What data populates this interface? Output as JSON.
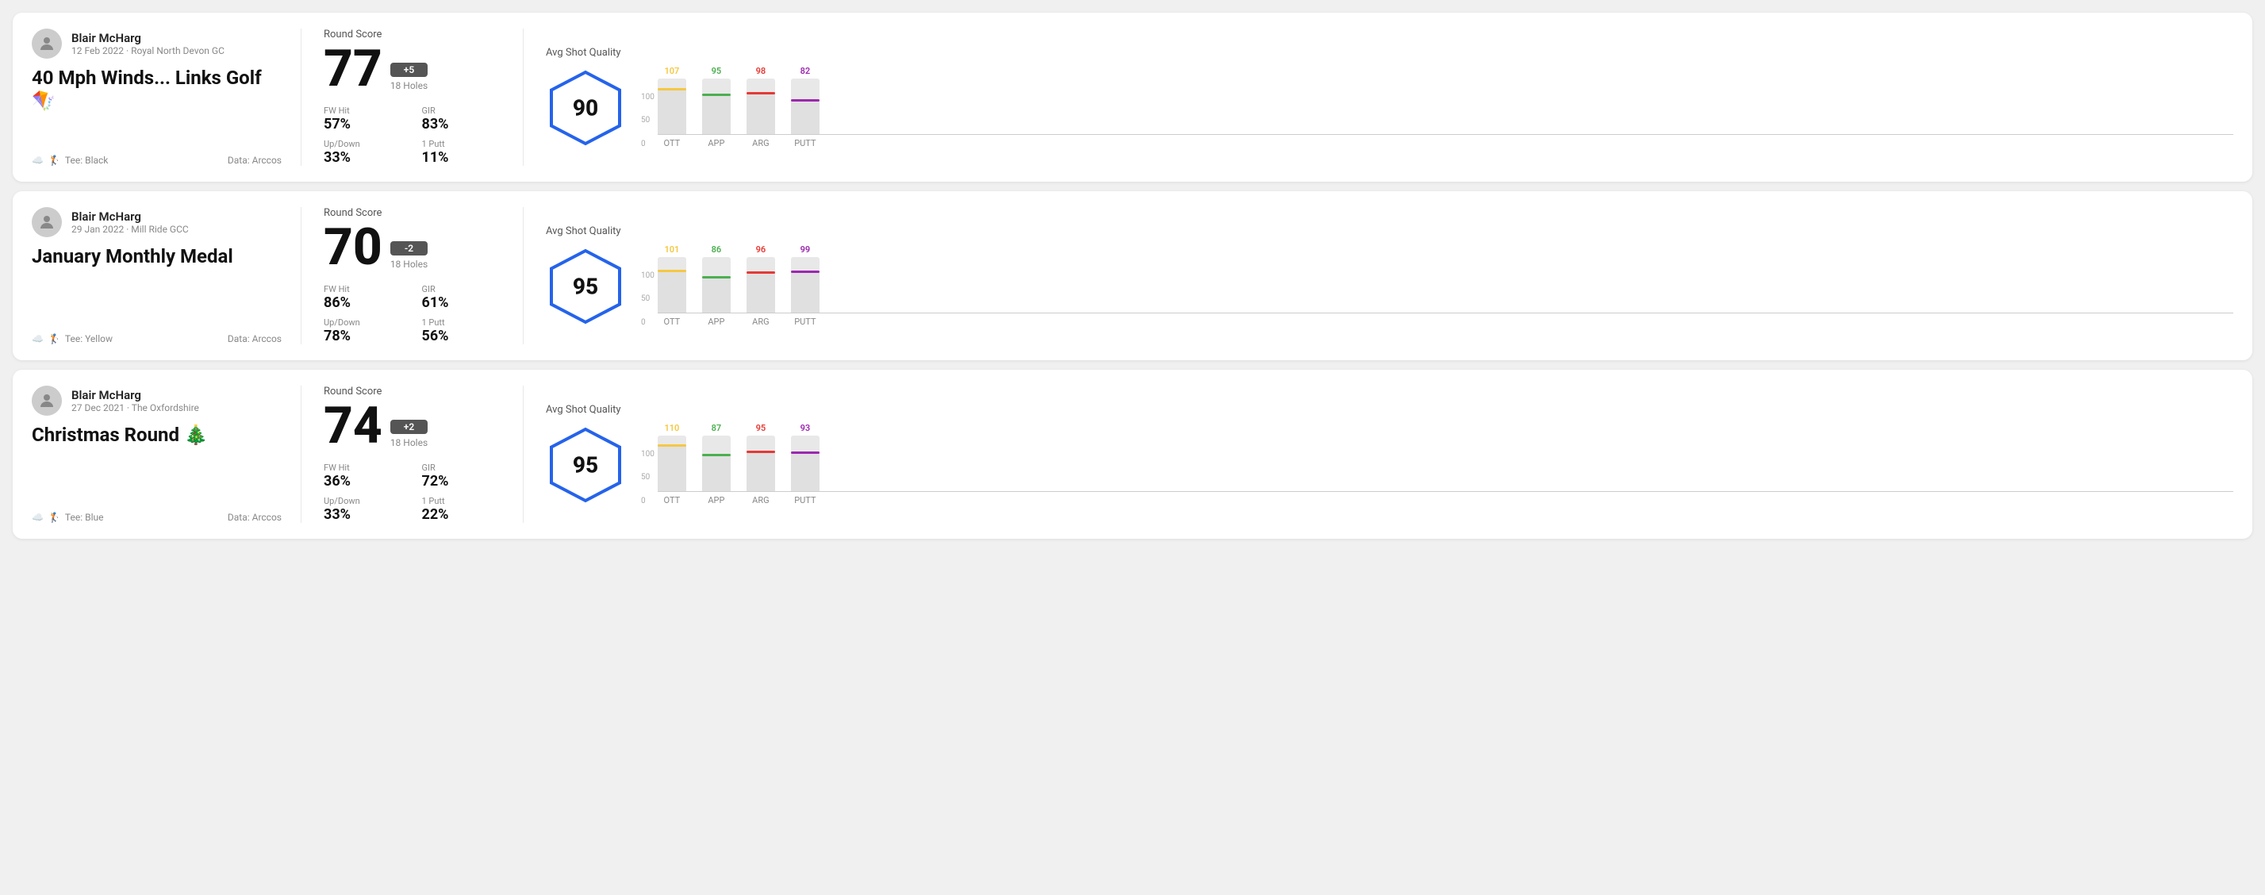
{
  "rounds": [
    {
      "id": "round-1",
      "player": {
        "name": "Blair McHarg",
        "date": "12 Feb 2022 · Royal North Devon GC"
      },
      "title": "40 Mph Winds... Links Golf 🪁",
      "tee": "Black",
      "data_source": "Arccos",
      "score": "77",
      "score_diff": "+5",
      "holes": "18 Holes",
      "fw_hit": "57%",
      "gir": "83%",
      "up_down": "33%",
      "one_putt": "11%",
      "avg_shot_quality": "90",
      "bars": [
        {
          "label": "OTT",
          "value": 107,
          "color": "#f5c842",
          "pct": 65
        },
        {
          "label": "APP",
          "value": 95,
          "color": "#4caf50",
          "pct": 55
        },
        {
          "label": "ARG",
          "value": 98,
          "color": "#e53935",
          "pct": 58
        },
        {
          "label": "PUTT",
          "value": 82,
          "color": "#9c27b0",
          "pct": 45
        }
      ]
    },
    {
      "id": "round-2",
      "player": {
        "name": "Blair McHarg",
        "date": "29 Jan 2022 · Mill Ride GCC"
      },
      "title": "January Monthly Medal",
      "tee": "Yellow",
      "data_source": "Arccos",
      "score": "70",
      "score_diff": "-2",
      "holes": "18 Holes",
      "fw_hit": "86%",
      "gir": "61%",
      "up_down": "78%",
      "one_putt": "56%",
      "avg_shot_quality": "95",
      "bars": [
        {
          "label": "OTT",
          "value": 101,
          "color": "#f5c842",
          "pct": 62
        },
        {
          "label": "APP",
          "value": 86,
          "color": "#4caf50",
          "pct": 48
        },
        {
          "label": "ARG",
          "value": 96,
          "color": "#e53935",
          "pct": 57
        },
        {
          "label": "PUTT",
          "value": 99,
          "color": "#9c27b0",
          "pct": 60
        }
      ]
    },
    {
      "id": "round-3",
      "player": {
        "name": "Blair McHarg",
        "date": "27 Dec 2021 · The Oxfordshire"
      },
      "title": "Christmas Round 🎄",
      "tee": "Blue",
      "data_source": "Arccos",
      "score": "74",
      "score_diff": "+2",
      "holes": "18 Holes",
      "fw_hit": "36%",
      "gir": "72%",
      "up_down": "33%",
      "one_putt": "22%",
      "avg_shot_quality": "95",
      "bars": [
        {
          "label": "OTT",
          "value": 110,
          "color": "#f5c842",
          "pct": 68
        },
        {
          "label": "APP",
          "value": 87,
          "color": "#4caf50",
          "pct": 49
        },
        {
          "label": "ARG",
          "value": 95,
          "color": "#e53935",
          "pct": 56
        },
        {
          "label": "PUTT",
          "value": 93,
          "color": "#9c27b0",
          "pct": 54
        }
      ]
    }
  ],
  "labels": {
    "round_score": "Round Score",
    "fw_hit": "FW Hit",
    "gir": "GIR",
    "up_down": "Up/Down",
    "one_putt": "1 Putt",
    "avg_shot_quality": "Avg Shot Quality",
    "tee_prefix": "Tee:",
    "data_prefix": "Data:",
    "y_axis": [
      "100",
      "50",
      "0"
    ]
  }
}
